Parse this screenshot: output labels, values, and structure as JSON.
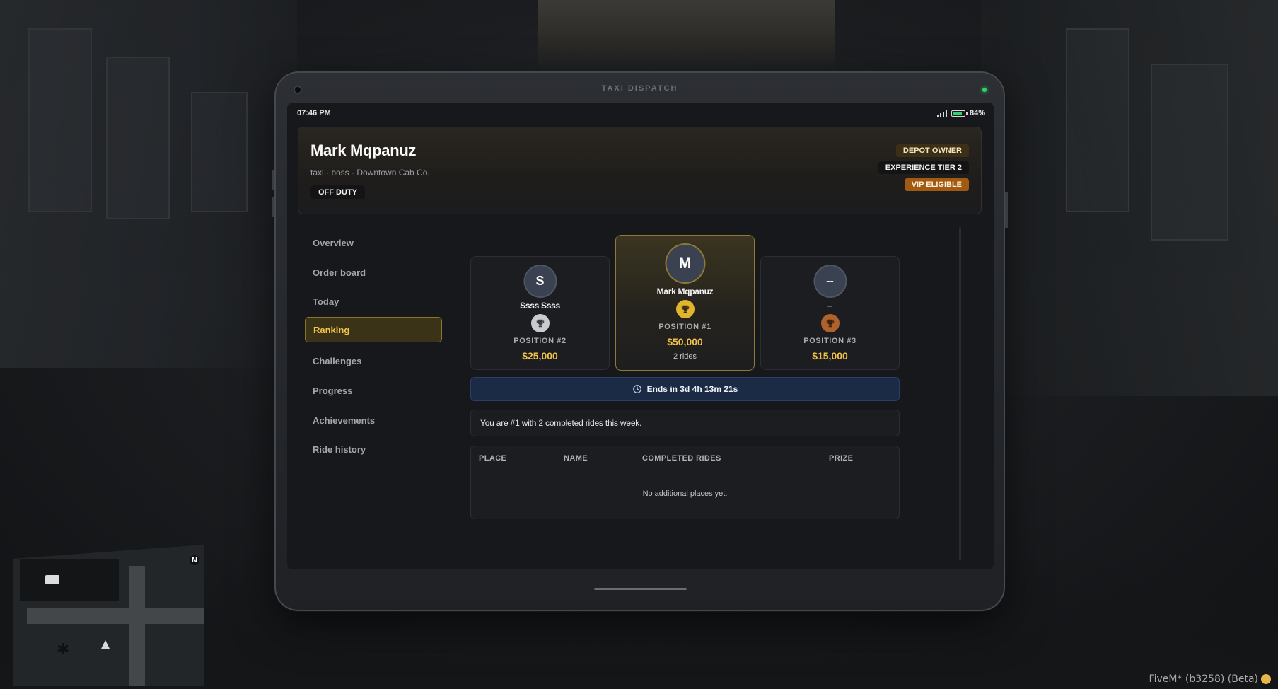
{
  "tablet": {
    "brand": "TAXI DISPATCH"
  },
  "statusbar": {
    "time": "07:46 PM",
    "battery": "84%",
    "battery_level": 0.84
  },
  "profile": {
    "name": "Mark Mqpanuz",
    "subtitle": "taxi · boss · Downtown Cab Co.",
    "duty": "OFF DUTY",
    "badges": {
      "owner": "DEPOT OWNER",
      "tier": "EXPERIENCE TIER 2",
      "vip": "VIP ELIGIBLE"
    }
  },
  "sidebar": {
    "items": [
      {
        "label": "Overview"
      },
      {
        "label": "Order board"
      },
      {
        "label": "Today"
      },
      {
        "label": "Ranking"
      },
      {
        "label": "Challenges"
      },
      {
        "label": "Progress"
      },
      {
        "label": "Achievements"
      },
      {
        "label": "Ride history"
      }
    ],
    "active": "Ranking"
  },
  "podium": {
    "second": {
      "initial": "S",
      "name": "Ssss Ssss",
      "position": "POSITION #2",
      "prize": "$25,000"
    },
    "first": {
      "initial": "M",
      "name": "Mark Mqpanuz",
      "position": "POSITION #1",
      "prize": "$50,000",
      "rides": "2 rides"
    },
    "third": {
      "initial": "--",
      "name": "--",
      "position": "POSITION #3",
      "prize": "$15,000"
    }
  },
  "timer": {
    "label": "Ends in 3d 4h 13m 21s"
  },
  "info": {
    "message": "You are #1 with 2 completed rides this week."
  },
  "table": {
    "headers": [
      "PLACE",
      "NAME",
      "COMPLETED RIDES",
      "PRIZE"
    ],
    "empty_text": "No additional places yet."
  },
  "colors": {
    "accent": "#f3c34a",
    "gold": "#e2b42e",
    "silver": "#c9cbd0",
    "bronze": "#b0622b",
    "timer_bg": "#1b2a45"
  },
  "overlay": {
    "fivem": "FiveM* (b3258) (Beta)"
  },
  "minimap": {
    "north": "N"
  }
}
